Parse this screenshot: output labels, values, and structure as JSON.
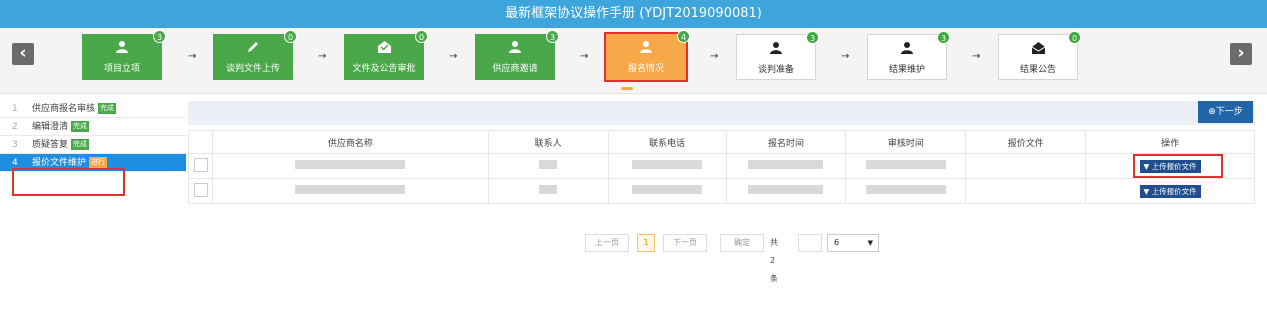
{
  "header": {
    "title": "最新框架协议操作手册 (YDJT2019090081)"
  },
  "stepbar": {
    "steps": [
      {
        "label": "项目立项",
        "count": "3",
        "icon": "user-icon"
      },
      {
        "label": "谈判文件上传",
        "count": "0",
        "icon": "pencil-icon"
      },
      {
        "label": "文件及公告审批",
        "count": "0",
        "icon": "envelope-check-icon"
      },
      {
        "label": "供应商邀请",
        "count": "3",
        "icon": "user-icon"
      },
      {
        "label": "报名情况",
        "count": "4",
        "icon": "user-icon"
      },
      {
        "label": "谈判准备",
        "count": "3",
        "icon": "user-icon"
      },
      {
        "label": "结果维护",
        "count": "3",
        "icon": "user-icon"
      },
      {
        "label": "结果公告",
        "count": "0",
        "icon": "envelope-icon"
      }
    ],
    "arrow": "→",
    "prev": "‹",
    "next": "›"
  },
  "sidebar": {
    "items": [
      {
        "num": "1",
        "label": "供应商报名审核",
        "tag": "完成"
      },
      {
        "num": "2",
        "label": "编辑澄清",
        "tag": "完成"
      },
      {
        "num": "3",
        "label": "质疑答复",
        "tag": "完成"
      },
      {
        "num": "4",
        "label": "报价文件维护",
        "tag": "进行"
      }
    ]
  },
  "toolbar": {
    "next_step": "⊕下一步"
  },
  "table": {
    "headers": [
      "供应商名称",
      "联系人",
      "联系电话",
      "报名时间",
      "审核时间",
      "报价文件",
      "操作"
    ],
    "upload_label": "上传报价文件"
  },
  "pager": {
    "prev": "上一页",
    "current": "1",
    "next": "下一页",
    "confirm": "确定",
    "total": "共2条",
    "page_size": "6"
  },
  "colors": {
    "title_bg": "#3da5db",
    "step_done": "#4aa84a",
    "step_active": "#f7a94a",
    "highlight": "#e0322c",
    "sidebar_active": "#1d8ee0"
  }
}
